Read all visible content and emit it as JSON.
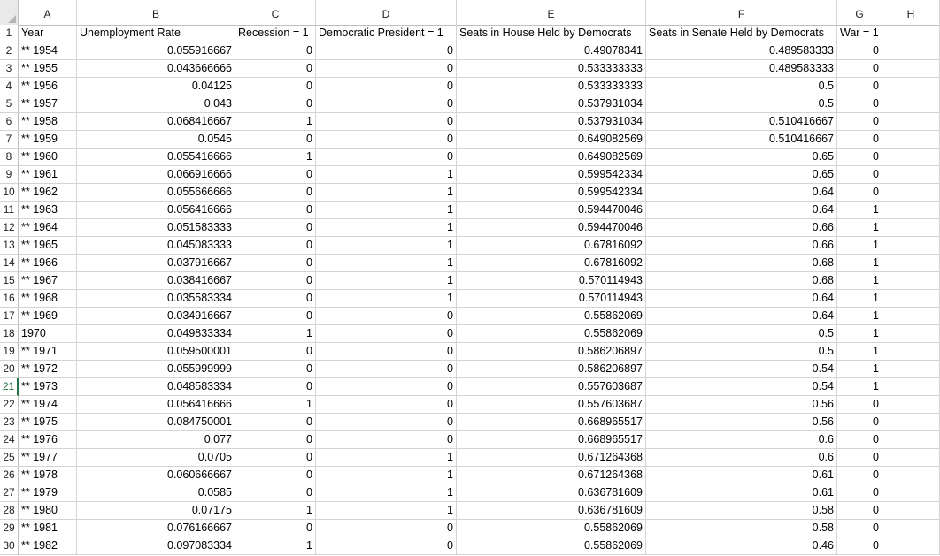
{
  "columns": [
    "A",
    "B",
    "C",
    "D",
    "E",
    "F",
    "G",
    "H"
  ],
  "header": {
    "year": "Year",
    "unemployment": "Unemployment Rate",
    "recession": "Recession = 1",
    "dem_president": "Democratic President = 1",
    "house": "Seats in House Held by Democrats",
    "senate": "Seats in Senate Held by Democrats",
    "war": "War = 1"
  },
  "rows": [
    {
      "num": "2",
      "year": "** 1954",
      "unemp": "0.055916667",
      "rec": "0",
      "dem": "0",
      "house": "0.49078341",
      "senate": "0.489583333",
      "war": "0"
    },
    {
      "num": "3",
      "year": "** 1955",
      "unemp": "0.043666666",
      "rec": "0",
      "dem": "0",
      "house": "0.533333333",
      "senate": "0.489583333",
      "war": "0"
    },
    {
      "num": "4",
      "year": "** 1956",
      "unemp": "0.04125",
      "rec": "0",
      "dem": "0",
      "house": "0.533333333",
      "senate": "0.5",
      "war": "0"
    },
    {
      "num": "5",
      "year": "** 1957",
      "unemp": "0.043",
      "rec": "0",
      "dem": "0",
      "house": "0.537931034",
      "senate": "0.5",
      "war": "0"
    },
    {
      "num": "6",
      "year": "** 1958",
      "unemp": "0.068416667",
      "rec": "1",
      "dem": "0",
      "house": "0.537931034",
      "senate": "0.510416667",
      "war": "0"
    },
    {
      "num": "7",
      "year": "** 1959",
      "unemp": "0.0545",
      "rec": "0",
      "dem": "0",
      "house": "0.649082569",
      "senate": "0.510416667",
      "war": "0"
    },
    {
      "num": "8",
      "year": "** 1960",
      "unemp": "0.055416666",
      "rec": "1",
      "dem": "0",
      "house": "0.649082569",
      "senate": "0.65",
      "war": "0"
    },
    {
      "num": "9",
      "year": "** 1961",
      "unemp": "0.066916666",
      "rec": "0",
      "dem": "1",
      "house": "0.599542334",
      "senate": "0.65",
      "war": "0"
    },
    {
      "num": "10",
      "year": "** 1962",
      "unemp": "0.055666666",
      "rec": "0",
      "dem": "1",
      "house": "0.599542334",
      "senate": "0.64",
      "war": "0"
    },
    {
      "num": "11",
      "year": "** 1963",
      "unemp": "0.056416666",
      "rec": "0",
      "dem": "1",
      "house": "0.594470046",
      "senate": "0.64",
      "war": "1"
    },
    {
      "num": "12",
      "year": "** 1964",
      "unemp": "0.051583333",
      "rec": "0",
      "dem": "1",
      "house": "0.594470046",
      "senate": "0.66",
      "war": "1"
    },
    {
      "num": "13",
      "year": "** 1965",
      "unemp": "0.045083333",
      "rec": "0",
      "dem": "1",
      "house": "0.67816092",
      "senate": "0.66",
      "war": "1"
    },
    {
      "num": "14",
      "year": "** 1966",
      "unemp": "0.037916667",
      "rec": "0",
      "dem": "1",
      "house": "0.67816092",
      "senate": "0.68",
      "war": "1"
    },
    {
      "num": "15",
      "year": "** 1967",
      "unemp": "0.038416667",
      "rec": "0",
      "dem": "1",
      "house": "0.570114943",
      "senate": "0.68",
      "war": "1"
    },
    {
      "num": "16",
      "year": "** 1968",
      "unemp": "0.035583334",
      "rec": "0",
      "dem": "1",
      "house": "0.570114943",
      "senate": "0.64",
      "war": "1"
    },
    {
      "num": "17",
      "year": "** 1969",
      "unemp": "0.034916667",
      "rec": "0",
      "dem": "0",
      "house": "0.55862069",
      "senate": "0.64",
      "war": "1"
    },
    {
      "num": "18",
      "year": "1970",
      "unemp": "0.049833334",
      "rec": "1",
      "dem": "0",
      "house": "0.55862069",
      "senate": "0.5",
      "war": "1"
    },
    {
      "num": "19",
      "year": "** 1971",
      "unemp": "0.059500001",
      "rec": "0",
      "dem": "0",
      "house": "0.586206897",
      "senate": "0.5",
      "war": "1"
    },
    {
      "num": "20",
      "year": "** 1972",
      "unemp": "0.055999999",
      "rec": "0",
      "dem": "0",
      "house": "0.586206897",
      "senate": "0.54",
      "war": "1"
    },
    {
      "num": "21",
      "year": "** 1973",
      "unemp": "0.048583334",
      "rec": "0",
      "dem": "0",
      "house": "0.557603687",
      "senate": "0.54",
      "war": "1"
    },
    {
      "num": "22",
      "year": "** 1974",
      "unemp": "0.056416666",
      "rec": "1",
      "dem": "0",
      "house": "0.557603687",
      "senate": "0.56",
      "war": "0"
    },
    {
      "num": "23",
      "year": "** 1975",
      "unemp": "0.084750001",
      "rec": "0",
      "dem": "0",
      "house": "0.668965517",
      "senate": "0.56",
      "war": "0"
    },
    {
      "num": "24",
      "year": "** 1976",
      "unemp": "0.077",
      "rec": "0",
      "dem": "0",
      "house": "0.668965517",
      "senate": "0.6",
      "war": "0"
    },
    {
      "num": "25",
      "year": "** 1977",
      "unemp": "0.0705",
      "rec": "0",
      "dem": "1",
      "house": "0.671264368",
      "senate": "0.6",
      "war": "0"
    },
    {
      "num": "26",
      "year": "** 1978",
      "unemp": "0.060666667",
      "rec": "0",
      "dem": "1",
      "house": "0.671264368",
      "senate": "0.61",
      "war": "0"
    },
    {
      "num": "27",
      "year": "** 1979",
      "unemp": "0.0585",
      "rec": "0",
      "dem": "1",
      "house": "0.636781609",
      "senate": "0.61",
      "war": "0"
    },
    {
      "num": "28",
      "year": "** 1980",
      "unemp": "0.07175",
      "rec": "1",
      "dem": "1",
      "house": "0.636781609",
      "senate": "0.58",
      "war": "0"
    },
    {
      "num": "29",
      "year": "** 1981",
      "unemp": "0.076166667",
      "rec": "0",
      "dem": "0",
      "house": "0.55862069",
      "senate": "0.58",
      "war": "0"
    },
    {
      "num": "30",
      "year": "** 1982",
      "unemp": "0.097083334",
      "rec": "1",
      "dem": "0",
      "house": "0.55862069",
      "senate": "0.46",
      "war": "0"
    }
  ],
  "active_row": "21",
  "colors": {
    "grid": "#d4d4d4",
    "header_border": "#bfbfbf",
    "accent": "#217346",
    "error_triangle": "#1e7a3a"
  }
}
